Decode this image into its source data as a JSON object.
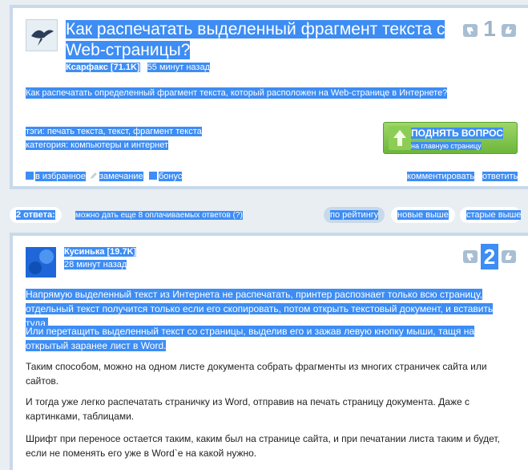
{
  "question": {
    "title": "Как распечатать выделенный фрагмент текста с Web-страницы?",
    "author": "Ксарфакс [71.1K]",
    "time": "55 минут назад",
    "rating": "1",
    "body": "Как распечатать определенный фрагмент текста, который расположен на Web-странице в Интернете?",
    "tags_line": "тэги: печать текста, текст, фрагмент текста",
    "category_line": "категория: компьютеры и интернет",
    "raise_button": {
      "title": "ПОДНЯТЬ ВОПРОС",
      "subtitle": "на главную страницу"
    },
    "actions": {
      "favorite": "в избранное",
      "remark": "замечание",
      "bonus": "бонус",
      "comment": "комментировать",
      "answer": "ответить"
    }
  },
  "answers_bar": {
    "count": "2 ответа:",
    "paid_note": "можно дать еще 8 оплачиваемых ответов (?)",
    "sort_rating": "по рейтингу",
    "sort_newest": "новые выше",
    "sort_oldest": "старые выше"
  },
  "answer": {
    "author": "Кусинька [19.7K]",
    "time": "28 минут назад",
    "rating": "2",
    "paragraphs": [
      "Напрямую выделенный текст из Интернета не распечатать, принтер распознает только всю страницу, отдельный текст получится только если его скопировать, потом открыть текстовый документ, и вставить туда.",
      "Или перетащить выделенный текст со страницы, выделив его и зажав левую кнопку мыши, тащя на открытый заранее лист в Word.",
      "Таким способом, можно на одном листе документа собрать фрагменты из многих страничек сайта или сайтов.",
      "И тогда уже легко распечатать страничку из Word, отправив на печать страницу документа. Даже с картинками, таблицами.",
      "Шрифт при переносе остается таким, каким был на странице сайта, и при печатании листа таким и будет, если не поменять его уже в Word`е на какой нужно."
    ]
  },
  "colors": {
    "selection": "#3d8df4",
    "button_green": "#7cc348",
    "border": "#c8d9ea",
    "page_bg": "#e9eef3"
  }
}
